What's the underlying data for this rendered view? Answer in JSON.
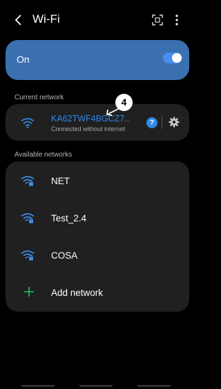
{
  "header": {
    "title": "Wi-Fi"
  },
  "wifi_toggle": {
    "label": "On",
    "enabled": true
  },
  "current_network": {
    "section_label": "Current network",
    "name": "KA62TWF4BGCZ7..",
    "status": "Connected without internet",
    "help_glyph": "?"
  },
  "annotation": {
    "number": "4"
  },
  "available_networks": {
    "section_label": "Available networks",
    "items": [
      {
        "name": "NET",
        "icon": "wifi-lock-icon"
      },
      {
        "name": "Test_2.4",
        "icon": "wifi-lock-icon"
      },
      {
        "name": "COSA",
        "icon": "wifi-lock-icon"
      }
    ],
    "add_label": "Add network"
  },
  "colors": {
    "accent": "#2f86e8",
    "toggle_card": "#3a6fb0",
    "card": "#202020",
    "add_icon": "#22b35a"
  }
}
